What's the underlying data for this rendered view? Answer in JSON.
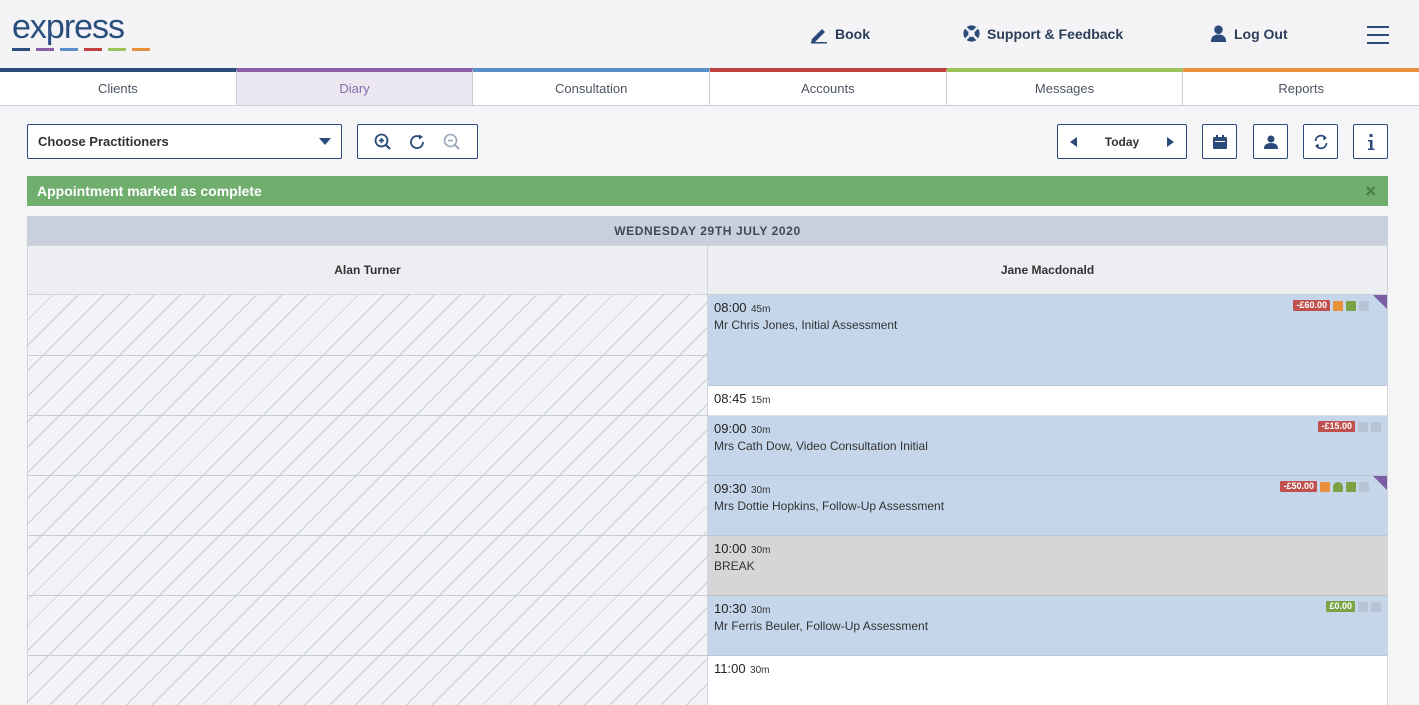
{
  "header": {
    "logo_text": "express",
    "logo_colors": [
      "#2a4f7f",
      "#8b5ea8",
      "#5b8fc9",
      "#c24040",
      "#9cc35a",
      "#e8913a"
    ],
    "book_label": "Book",
    "support_label": "Support & Feedback",
    "logout_label": "Log Out"
  },
  "tabs": [
    {
      "label": "Clients",
      "color": "#2b4a7a"
    },
    {
      "label": "Diary",
      "color": "#8b5ea8"
    },
    {
      "label": "Consultation",
      "color": "#5b8fc9"
    },
    {
      "label": "Accounts",
      "color": "#c24040"
    },
    {
      "label": "Messages",
      "color": "#9cc35a"
    },
    {
      "label": "Reports",
      "color": "#e8913a"
    }
  ],
  "toolbar": {
    "practitioner_select": "Choose Practitioners",
    "today_label": "Today"
  },
  "alert": {
    "message": "Appointment marked as complete",
    "close_glyph": "×"
  },
  "diary": {
    "date": "WEDNESDAY 29TH JULY 2020",
    "practitioners": [
      "Alan Turner",
      "Jane Macdonald"
    ],
    "appointments": [
      {
        "time": "08:00",
        "duration": "45m",
        "description": "Mr Chris Jones, Initial Assessment",
        "status": "booked",
        "balance": "-£60.00",
        "balance_color": "#c0504d",
        "flag": true
      },
      {
        "time": "08:45",
        "duration": "15m",
        "description": "",
        "status": "free"
      },
      {
        "time": "09:00",
        "duration": "30m",
        "description": "Mrs Cath Dow, Video Consultation Initial",
        "status": "booked",
        "balance": "-£15.00",
        "balance_color": "#c0504d",
        "flag": false
      },
      {
        "time": "09:30",
        "duration": "30m",
        "description": "Mrs Dottie Hopkins, Follow-Up Assessment",
        "status": "booked",
        "balance": "-£50.00",
        "balance_color": "#c0504d",
        "flag": true
      },
      {
        "time": "10:00",
        "duration": "30m",
        "description": "BREAK",
        "status": "break"
      },
      {
        "time": "10:30",
        "duration": "30m",
        "description": "Mr Ferris Beuler, Follow-Up Assessment",
        "status": "booked",
        "balance": "£0.00",
        "balance_color": "#7aa344",
        "flag": false
      },
      {
        "time": "11:00",
        "duration": "30m",
        "description": "",
        "status": "free"
      }
    ]
  }
}
